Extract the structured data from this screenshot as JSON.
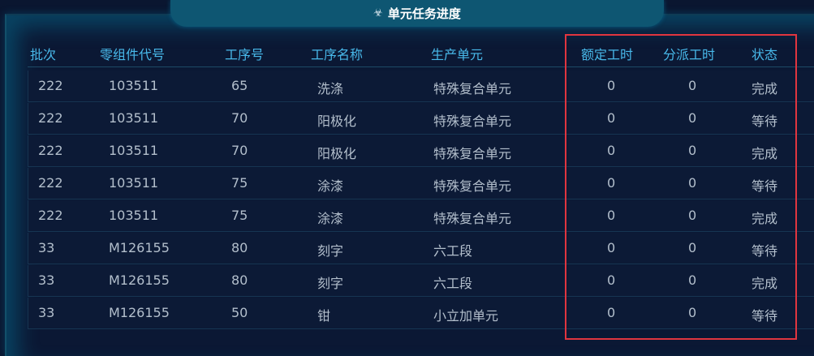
{
  "panel": {
    "title": "单元任务进度",
    "title_icon": "biohazard-icon"
  },
  "table": {
    "headers": [
      "批次",
      "零组件代号",
      "工序号",
      "工序名称",
      "生产单元",
      "额定工时",
      "分派工时",
      "状态"
    ],
    "rows": [
      [
        "222",
        "103511",
        "65",
        "洗涤",
        "特殊复合单元",
        "0",
        "0",
        "完成"
      ],
      [
        "222",
        "103511",
        "70",
        "阳极化",
        "特殊复合单元",
        "0",
        "0",
        "等待"
      ],
      [
        "222",
        "103511",
        "70",
        "阳极化",
        "特殊复合单元",
        "0",
        "0",
        "完成"
      ],
      [
        "222",
        "103511",
        "75",
        "涂漆",
        "特殊复合单元",
        "0",
        "0",
        "等待"
      ],
      [
        "222",
        "103511",
        "75",
        "涂漆",
        "特殊复合单元",
        "0",
        "0",
        "完成"
      ],
      [
        "33",
        "M126155",
        "80",
        "刻字",
        "六工段",
        "0",
        "0",
        "等待"
      ],
      [
        "33",
        "M126155",
        "80",
        "刻字",
        "六工段",
        "0",
        "0",
        "完成"
      ],
      [
        "33",
        "M126155",
        "50",
        "钳",
        "小立加单元",
        "0",
        "0",
        "等待"
      ]
    ]
  },
  "colors": {
    "background": "#0a1630",
    "title_bar": "#0e5672",
    "header_text": "#48b9ea",
    "cell_text": "#b3bfcc",
    "highlight_box": "#e0353f"
  }
}
